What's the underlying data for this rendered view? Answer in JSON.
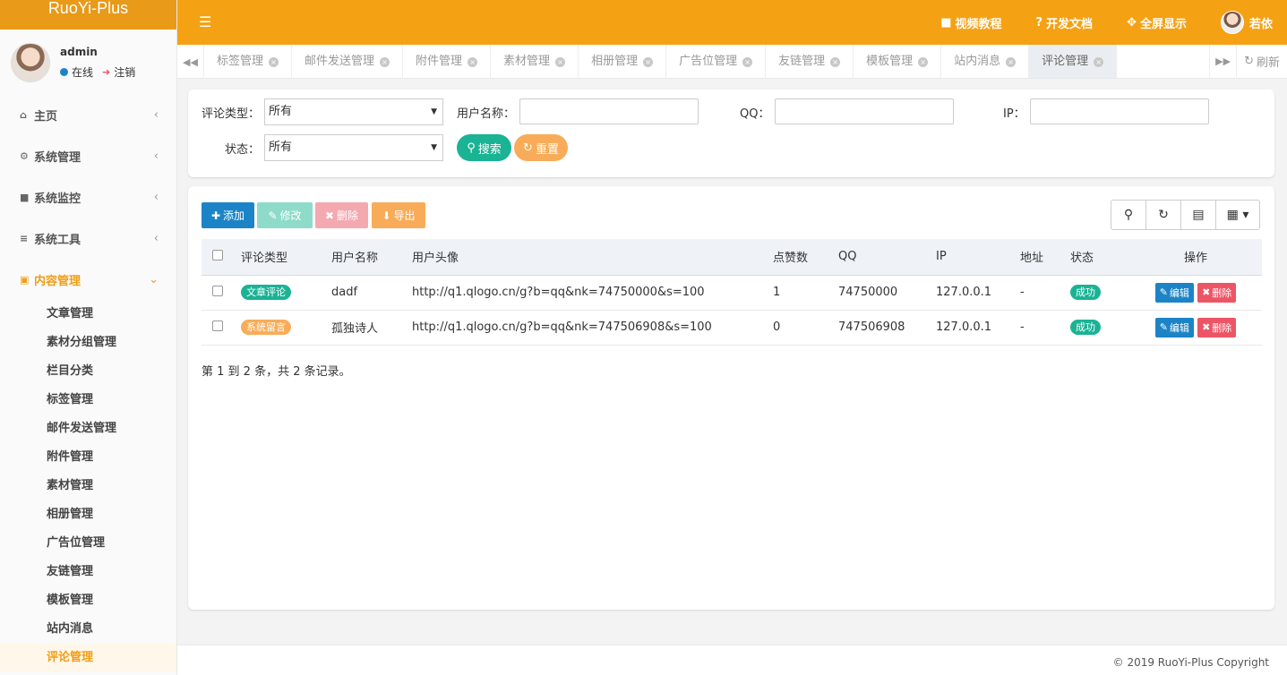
{
  "app": {
    "title": "RuoYi-Plus"
  },
  "user": {
    "name": "admin",
    "status": "在线",
    "logout": "注销"
  },
  "sidebar": {
    "items": [
      {
        "label": "主页",
        "icon": "home-icon"
      },
      {
        "label": "系统管理",
        "icon": "gear-icon"
      },
      {
        "label": "系统监控",
        "icon": "video-icon"
      },
      {
        "label": "系统工具",
        "icon": "bars-icon"
      },
      {
        "label": "内容管理",
        "icon": "content-icon",
        "active": true
      }
    ],
    "submenu": [
      "文章管理",
      "素材分组管理",
      "栏目分类",
      "标签管理",
      "邮件发送管理",
      "附件管理",
      "素材管理",
      "相册管理",
      "广告位管理",
      "友链管理",
      "模板管理",
      "站内消息",
      "评论管理"
    ]
  },
  "header": {
    "links": [
      "视频教程",
      "开发文档",
      "全屏显示"
    ],
    "username": "若依"
  },
  "tabs": {
    "items": [
      "标签管理",
      "邮件发送管理",
      "附件管理",
      "素材管理",
      "相册管理",
      "广告位管理",
      "友链管理",
      "模板管理",
      "站内消息",
      "评论管理"
    ],
    "active": "评论管理",
    "refresh": "刷新"
  },
  "search": {
    "type_label": "评论类型：",
    "type_value": "所有",
    "username_label": "用户名称：",
    "qq_label": "QQ：",
    "ip_label": "IP：",
    "status_label": "状态：",
    "status_value": "所有",
    "search_btn": "搜索",
    "reset_btn": "重置"
  },
  "toolbar": {
    "add": "添加",
    "edit": "修改",
    "delete": "删除",
    "export": "导出"
  },
  "table": {
    "headers": [
      "评论类型",
      "用户名称",
      "用户头像",
      "点赞数",
      "QQ",
      "IP",
      "地址",
      "状态",
      "操作"
    ],
    "rows": [
      {
        "type": "文章评论",
        "type_color": "#1ab394",
        "username": "dadf",
        "avatar": "http://q1.qlogo.cn/g?b=qq&nk=74750000&s=100",
        "likes": "1",
        "qq": "74750000",
        "ip": "127.0.0.1",
        "address": "-",
        "status": "成功"
      },
      {
        "type": "系统留言",
        "type_color": "#f8ac59",
        "username": "孤独诗人",
        "avatar": "http://q1.qlogo.cn/g?b=qq&nk=747506908&s=100",
        "likes": "0",
        "qq": "747506908",
        "ip": "127.0.0.1",
        "address": "-",
        "status": "成功"
      }
    ],
    "edit_label": "编辑",
    "delete_label": "删除",
    "pagination": "第 1 到 2 条，共 2 条记录。"
  },
  "footer": {
    "copyright": "© 2019 RuoYi-Plus Copyright"
  },
  "colors": {
    "accent": "#f5a114",
    "primary": "#1c84c6",
    "success": "#1ab394",
    "warning": "#f8ac59",
    "danger": "#ed5565"
  }
}
